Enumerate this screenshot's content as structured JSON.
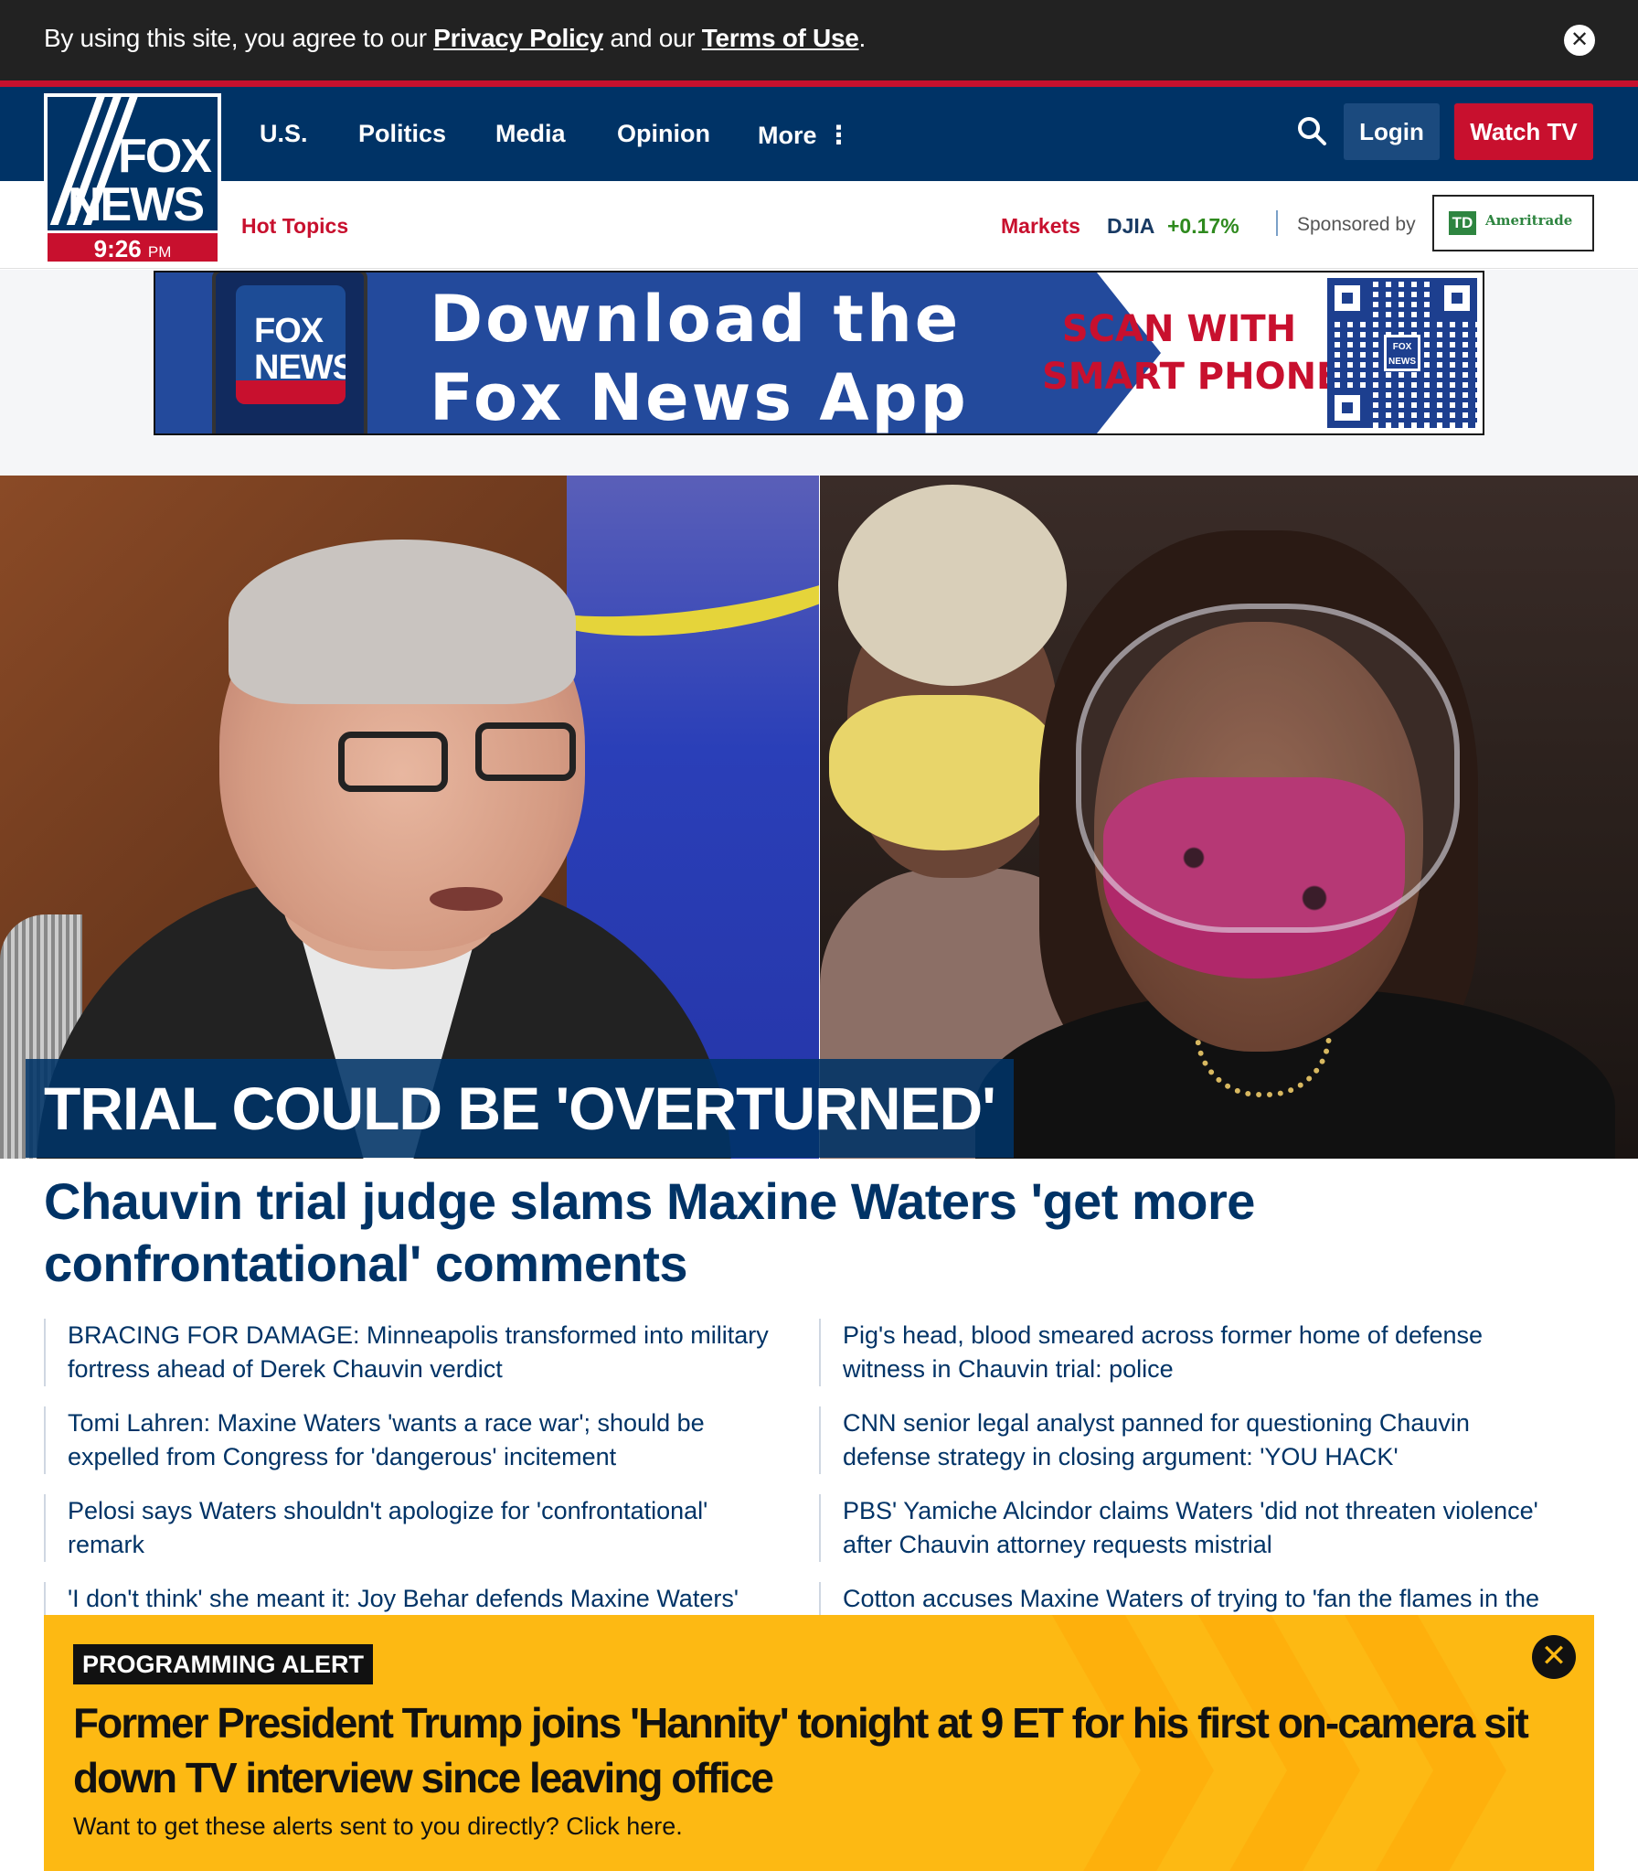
{
  "cookie_bar": {
    "text_before": "By using this site, you agree to our ",
    "privacy_link": "Privacy Policy",
    "text_middle": " and our ",
    "terms_link": "Terms of Use",
    "text_after": ".",
    "close_icon": "close-icon"
  },
  "header": {
    "logo": {
      "line1": "FOX",
      "line2": "NEWS",
      "time": "9:26",
      "ampm": "PM"
    },
    "nav": [
      "U.S.",
      "Politics",
      "Media",
      "Opinion",
      "More"
    ],
    "more_icon": "⋮",
    "search_icon": "search-icon",
    "login_label": "Login",
    "watch_label": "Watch TV",
    "brand_blue": "#003366",
    "brand_red": "#c8102e"
  },
  "subbar": {
    "hot_topics": "Hot Topics",
    "markets": "Markets",
    "djia_label": "DJIA",
    "djia_change": "+0.17%",
    "sponsored": "Sponsored by",
    "sponsor_name": "Ameritrade",
    "sponsor_logo_text": "TD"
  },
  "ad": {
    "phone_logo_line1": "FOX",
    "phone_logo_line2": "NEWS",
    "headline_line1": "Download the",
    "headline_line2": "Fox News App",
    "scan_line1": "SCAN WITH",
    "scan_line2": "SMART PHONE",
    "qr_logo_line1": "FOX",
    "qr_logo_line2": "NEWS"
  },
  "hero": {
    "label": "TRIAL COULD BE 'OVERTURNED'",
    "headline": "Chauvin trial judge slams Maxine Waters 'get more confrontational' comments"
  },
  "related": {
    "left": [
      "BRACING FOR DAMAGE: Minneapolis transformed into military fortress ahead of Derek Chauvin verdict",
      "Tomi Lahren: Maxine Waters 'wants a race war'; should be expelled from Congress for 'dangerous' incitement",
      "Pelosi says Waters shouldn't apologize for 'confrontational' remark",
      "'I don't think' she meant it: Joy Behar defends Maxine Waters'"
    ],
    "right": [
      "Pig's head, blood smeared across former home of defense witness in Chauvin trial: police",
      "CNN senior legal analyst panned for questioning Chauvin defense strategy in closing argument: 'YOU HACK'",
      "PBS' Yamiche Alcindor claims Waters 'did not threaten violence' after Chauvin attorney requests mistrial",
      "Cotton accuses Maxine Waters of trying to 'fan the flames in the"
    ]
  },
  "alert": {
    "tag": "PROGRAMMING ALERT",
    "headline": "Former President Trump joins 'Hannity' tonight at 9 ET for his first on-camera sit down TV interview since leaving office",
    "sub": "Want to get these alerts sent to you directly? Click here.",
    "close_icon": "close-icon",
    "color": "#fdb913"
  }
}
